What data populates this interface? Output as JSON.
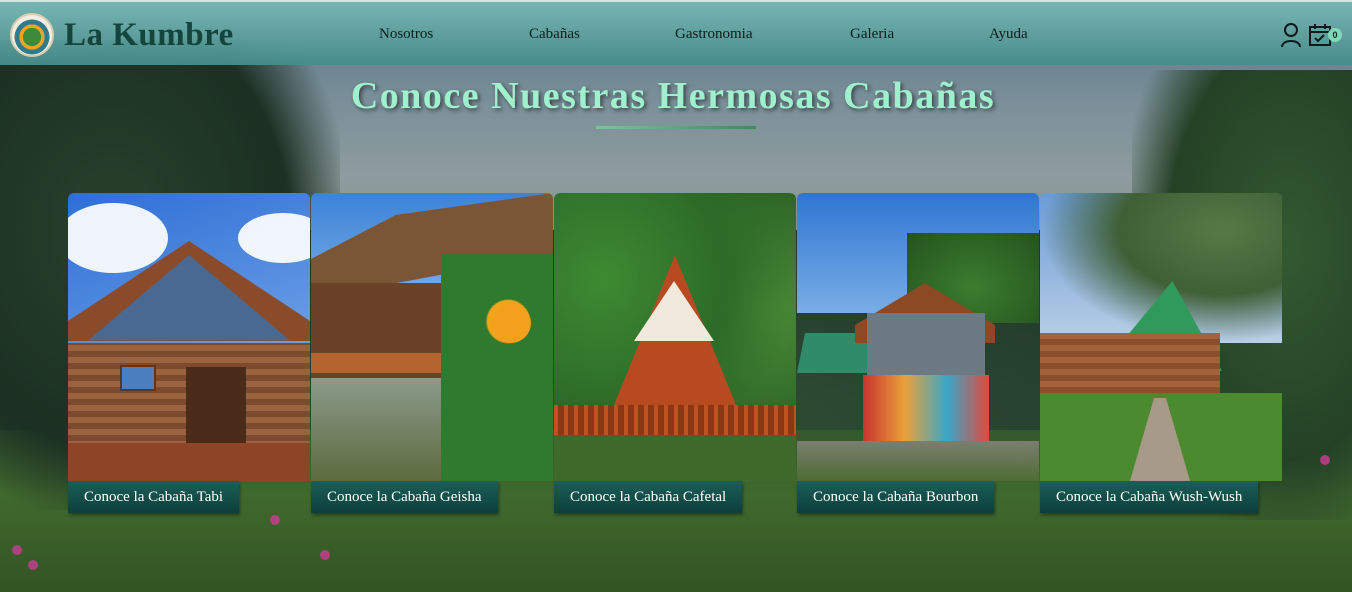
{
  "brand": {
    "name": "La Kumbre",
    "logo": "la-kumbre-logo"
  },
  "nav": [
    {
      "label": "Nosotros"
    },
    {
      "label": "Cabañas"
    },
    {
      "label": "Gastronomia"
    },
    {
      "label": "Galeria"
    },
    {
      "label": "Ayuda"
    }
  ],
  "header_icons": {
    "user": "user-icon",
    "cart": "calendar-cart-icon",
    "cart_count": "0"
  },
  "hero": {
    "title": "Conoce Nuestras Hermosas Cabañas"
  },
  "cabins": [
    {
      "button": "Conoce la Cabaña Tabi"
    },
    {
      "button": "Conoce la Cabaña Geisha"
    },
    {
      "button": "Conoce la Cabaña Cafetal"
    },
    {
      "button": "Conoce la Cabaña Bourbon"
    },
    {
      "button": "Conoce la Cabaña Wush-Wush"
    }
  ],
  "colors": {
    "header": "#5aa6a2",
    "brand": "#15443c",
    "title": "#9ff0cc",
    "button": "#0d3f3b"
  }
}
